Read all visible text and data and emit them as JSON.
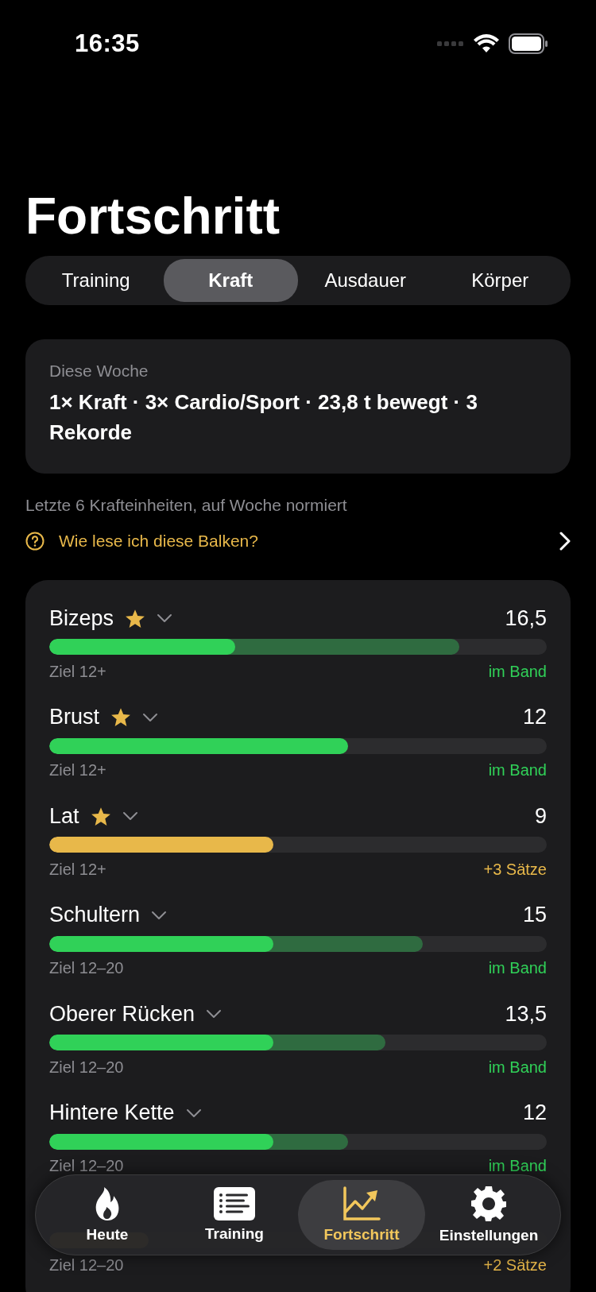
{
  "status_bar": {
    "time": "16:35"
  },
  "title": "Fortschritt",
  "tabs": [
    {
      "label": "Training",
      "selected": false
    },
    {
      "label": "Kraft",
      "selected": true
    },
    {
      "label": "Ausdauer",
      "selected": false
    },
    {
      "label": "Körper",
      "selected": false
    }
  ],
  "summary": {
    "label": "Diese Woche",
    "text": "1× Kraft · 3× Cardio/Sport · 23,8 t bewegt · 3 Rekorde"
  },
  "subtitle": "Letzte 6 Krafteinheiten, auf Woche normiert",
  "help_link": "Wie lese ich diese Balken?",
  "muscles": [
    {
      "name": "Bizeps",
      "starred": true,
      "value": "16,5",
      "level": 0.374,
      "range": {
        "level": 0.824
      },
      "goal": "Ziel 12+",
      "status": "im Band",
      "kind": "ok"
    },
    {
      "name": "Brust",
      "starred": true,
      "value": "12",
      "level": 0.6,
      "goal": "Ziel 12+",
      "status": "im Band",
      "kind": "ok"
    },
    {
      "name": "Lat",
      "starred": true,
      "value": "9",
      "level": 0.45,
      "goal": "Ziel 12+",
      "status": "+3 Sätze",
      "kind": "under"
    },
    {
      "name": "Schultern",
      "starred": false,
      "value": "15",
      "level": 0.45,
      "range": {
        "level": 0.75
      },
      "goal": "Ziel 12–20",
      "status": "im Band",
      "kind": "ok"
    },
    {
      "name": "Oberer Rücken",
      "starred": false,
      "value": "13,5",
      "level": 0.45,
      "range": {
        "level": 0.675
      },
      "goal": "Ziel 12–20",
      "status": "im Band",
      "kind": "ok"
    },
    {
      "name": "Hintere Kette",
      "starred": false,
      "value": "12",
      "level": 0.45,
      "range": {
        "level": 0.6
      },
      "goal": "Ziel 12–20",
      "status": "im Band",
      "kind": "ok"
    },
    {
      "level": 0.2,
      "goal": "Ziel 12–20",
      "status": "+2 Sätze",
      "kind": "under"
    }
  ],
  "tab_bar": [
    {
      "label": "Heute",
      "kind": "flame",
      "selected": false
    },
    {
      "label": "Training",
      "kind": "list",
      "selected": false
    },
    {
      "label": "Fortschritt",
      "kind": "chart",
      "selected": true
    },
    {
      "label": "Einstellungen",
      "kind": "gear",
      "selected": false
    }
  ]
}
